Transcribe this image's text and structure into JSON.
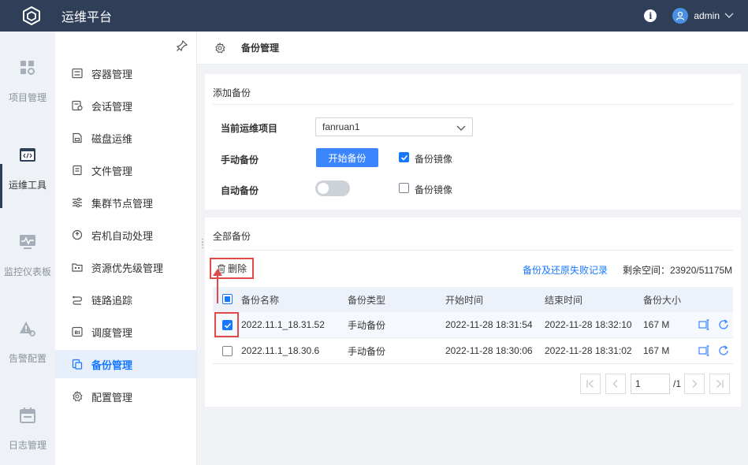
{
  "app": {
    "title": "运维平台",
    "user": "admin"
  },
  "rail": [
    {
      "label": "项目管理",
      "icon": "grid-gear-icon",
      "active": false
    },
    {
      "label": "运维工具",
      "icon": "code-window-icon",
      "active": true
    },
    {
      "label": "监控仪表板",
      "icon": "monitor-pulse-icon",
      "active": false
    },
    {
      "label": "告警配置",
      "icon": "warning-gear-icon",
      "active": false
    },
    {
      "label": "日志管理",
      "icon": "calendar-icon",
      "active": false
    }
  ],
  "subnav": [
    {
      "label": "容器管理",
      "icon": "container-icon"
    },
    {
      "label": "会话管理",
      "icon": "session-icon"
    },
    {
      "label": "磁盘运维",
      "icon": "disk-icon"
    },
    {
      "label": "文件管理",
      "icon": "file-icon"
    },
    {
      "label": "集群节点管理",
      "icon": "sliders-icon"
    },
    {
      "label": "宕机自动处理",
      "icon": "auto-recover-icon"
    },
    {
      "label": "资源优先级管理",
      "icon": "folder-priority-icon"
    },
    {
      "label": "链路追踪",
      "icon": "trace-icon"
    },
    {
      "label": "调度管理",
      "icon": "bi-icon"
    },
    {
      "label": "备份管理",
      "icon": "backup-icon",
      "active": true
    },
    {
      "label": "配置管理",
      "icon": "config-gear-icon"
    }
  ],
  "page": {
    "title": "备份管理"
  },
  "add_backup": {
    "title": "添加备份",
    "project_label": "当前运维项目",
    "project_value": "fanruan1",
    "manual_label": "手动备份",
    "start_button": "开始备份",
    "manual_mirror_label": "备份镜像",
    "manual_mirror_checked": true,
    "auto_label": "自动备份",
    "auto_enabled": false,
    "auto_mirror_label": "备份镜像",
    "auto_mirror_checked": false
  },
  "all_backups": {
    "title": "全部备份",
    "delete_button": "删除",
    "failure_link": "备份及还原失败记录",
    "space_text": "剩余空间：23920/51175M",
    "columns": [
      "备份名称",
      "备份类型",
      "开始时间",
      "结束时间",
      "备份大小"
    ],
    "rows": [
      {
        "name": "2022.11.1_18.31.52",
        "type": "手动备份",
        "start": "2022-11-28 18:31:54",
        "end": "2022-11-28 18:32:10",
        "size": "167 M",
        "checked": true
      },
      {
        "name": "2022.11.1_18.30.6",
        "type": "手动备份",
        "start": "2022-11-28 18:30:06",
        "end": "2022-11-28 18:31:02",
        "size": "167 M",
        "checked": false
      }
    ],
    "pager": {
      "page": "1",
      "total": "/1"
    }
  },
  "colors": {
    "topbar": "#2f3f58",
    "accent": "#1677ff",
    "highlight_red": "#e04a4a"
  }
}
